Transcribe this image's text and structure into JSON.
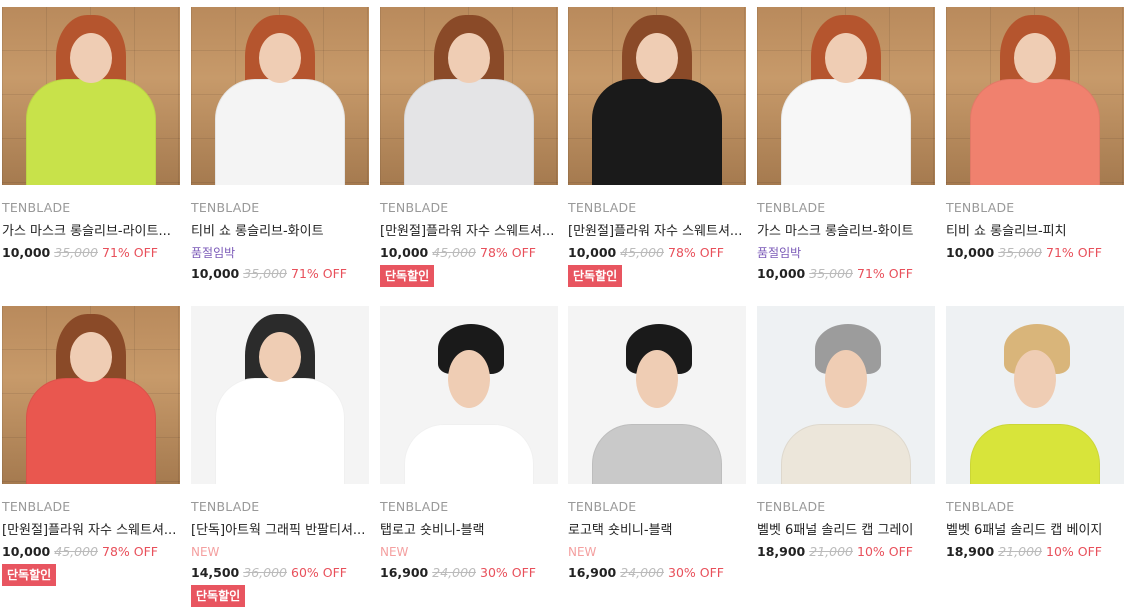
{
  "products": [
    {
      "brand": "TENBLADE",
      "name": "가스 마스크 롱슬리브-라이트...",
      "tag": "",
      "tag_type": "",
      "price": "10,000",
      "original": "35,000",
      "discount": "71% OFF",
      "badge": "",
      "bg": "box",
      "shirt_color": "#c8e24a",
      "hair_color": "#b5552e"
    },
    {
      "brand": "TENBLADE",
      "name": "티비 쇼 롱슬리브-화이트",
      "tag": "품절임박",
      "tag_type": "soldout",
      "price": "10,000",
      "original": "35,000",
      "discount": "71% OFF",
      "badge": "",
      "bg": "box",
      "shirt_color": "#f4f4f4",
      "hair_color": "#b5552e"
    },
    {
      "brand": "TENBLADE",
      "name": "[만원절]플라워 자수 스웨트셔...",
      "tag": "",
      "tag_type": "",
      "price": "10,000",
      "original": "45,000",
      "discount": "78% OFF",
      "badge": "단독할인",
      "bg": "box",
      "shirt_color": "#e4e4e6",
      "hair_color": "#8a4a28"
    },
    {
      "brand": "TENBLADE",
      "name": "[만원절]플라워 자수 스웨트셔...",
      "tag": "",
      "tag_type": "",
      "price": "10,000",
      "original": "45,000",
      "discount": "78% OFF",
      "badge": "단독할인",
      "bg": "box",
      "shirt_color": "#1a1a1a",
      "hair_color": "#8a4a28"
    },
    {
      "brand": "TENBLADE",
      "name": "가스 마스크 롱슬리브-화이트",
      "tag": "품절임박",
      "tag_type": "soldout",
      "price": "10,000",
      "original": "35,000",
      "discount": "71% OFF",
      "badge": "",
      "bg": "box",
      "shirt_color": "#f7f7f7",
      "hair_color": "#b5552e"
    },
    {
      "brand": "TENBLADE",
      "name": "티비 쇼 롱슬리브-피치",
      "tag": "",
      "tag_type": "",
      "price": "10,000",
      "original": "35,000",
      "discount": "71% OFF",
      "badge": "",
      "bg": "box",
      "shirt_color": "#f0816e",
      "hair_color": "#b5552e"
    },
    {
      "brand": "TENBLADE",
      "name": "[만원절]플라워 자수 스웨트셔...",
      "tag": "",
      "tag_type": "",
      "price": "10,000",
      "original": "45,000",
      "discount": "78% OFF",
      "badge": "단독할인",
      "bg": "box",
      "shirt_color": "#e9574f",
      "hair_color": "#8a4a28"
    },
    {
      "brand": "TENBLADE",
      "name": "[단독]아트웍 그래픽 반팔티셔...",
      "tag": "NEW",
      "tag_type": "new",
      "price": "14,500",
      "original": "36,000",
      "discount": "60% OFF",
      "badge": "단독할인",
      "bg": "white",
      "shirt_color": "#ffffff",
      "hair_color": "#2b2b2b"
    },
    {
      "brand": "TENBLADE",
      "name": "탭로고 숏비니-블랙",
      "tag": "NEW",
      "tag_type": "new",
      "price": "16,900",
      "original": "24,000",
      "discount": "30% OFF",
      "badge": "",
      "bg": "white",
      "shirt_color": "#ffffff",
      "hair_color": "#1a1a1a"
    },
    {
      "brand": "TENBLADE",
      "name": "로고택 숏비니-블랙",
      "tag": "NEW",
      "tag_type": "new",
      "price": "16,900",
      "original": "24,000",
      "discount": "30% OFF",
      "badge": "",
      "bg": "white",
      "shirt_color": "#c9c9c9",
      "hair_color": "#1a1a1a"
    },
    {
      "brand": "TENBLADE",
      "name": "벨벳 6패널 솔리드 캡 그레이",
      "tag": "",
      "tag_type": "",
      "price": "18,900",
      "original": "21,000",
      "discount": "10% OFF",
      "badge": "",
      "bg": "light",
      "shirt_color": "#ece6da",
      "hair_color": "#9c9c9c"
    },
    {
      "brand": "TENBLADE",
      "name": "벨벳 6패널 솔리드 캡 베이지",
      "tag": "",
      "tag_type": "",
      "price": "18,900",
      "original": "21,000",
      "discount": "10% OFF",
      "badge": "",
      "bg": "light",
      "shirt_color": "#d8e43a",
      "hair_color": "#d9b57a"
    }
  ]
}
